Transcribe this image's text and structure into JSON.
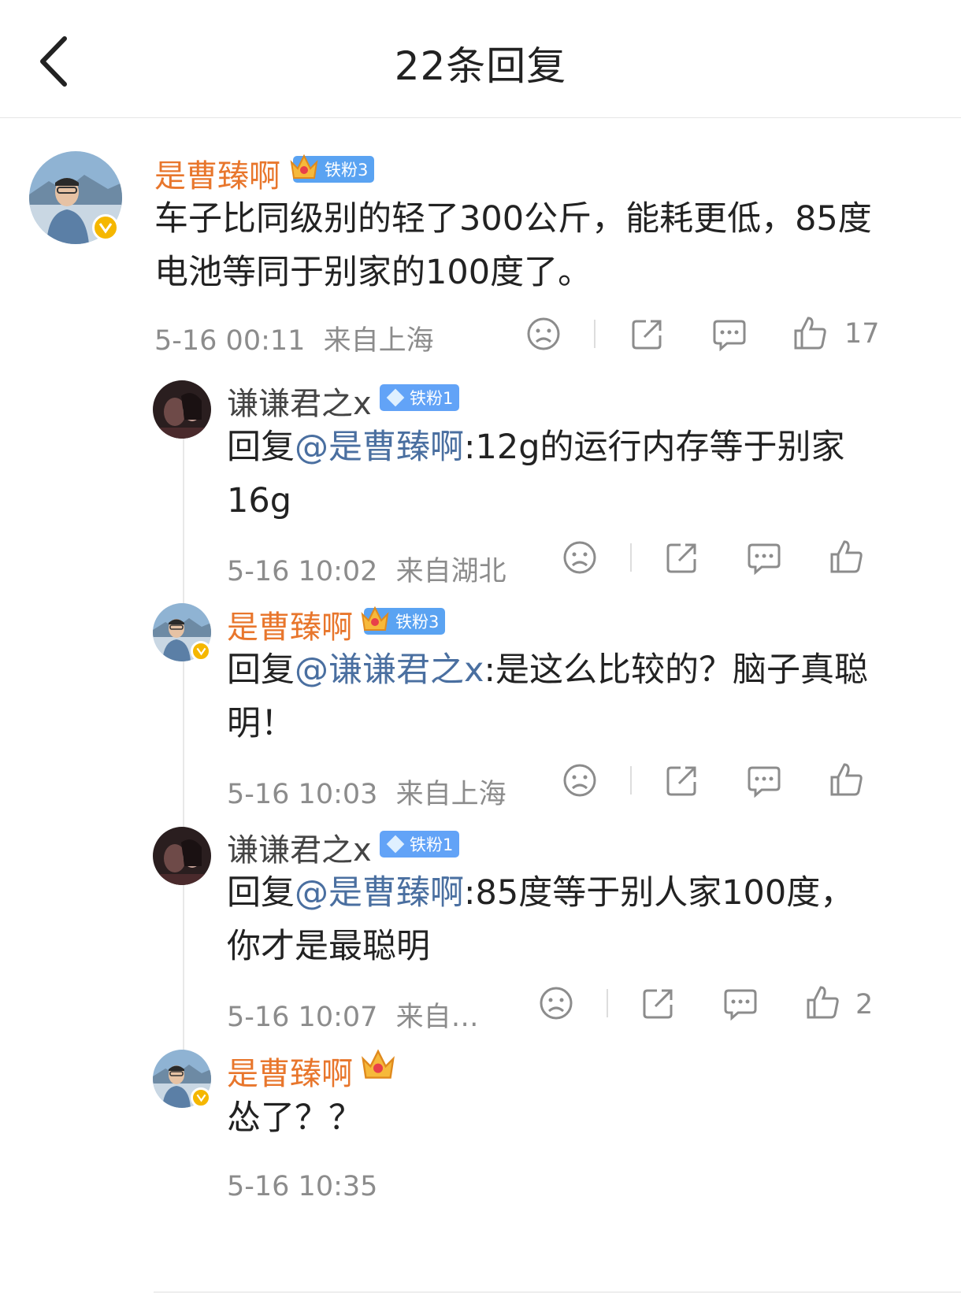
{
  "header": {
    "title": "22条回复"
  },
  "main_comment": {
    "author": "是曹臻啊",
    "fan_badge": "铁粉3",
    "text": "车子比同级别的轻了300公斤，能耗更低，85度电池等同于别家的100度了。",
    "time": "5-16 00:11",
    "location": "来自上海",
    "likes": "17"
  },
  "replies": [
    {
      "author": "谦谦君之x",
      "fan_badge": "铁粉1",
      "prefix": "回复",
      "mention": "@是曹臻啊",
      "text": ":12g的运行内存等于别家16g",
      "time": "5-16 10:02",
      "location": "来自湖北",
      "likes": ""
    },
    {
      "author": "是曹臻啊",
      "fan_badge": "铁粉3",
      "prefix": "回复",
      "mention": "@谦谦君之x",
      "text": ":是这么比较的？脑子真聪明！",
      "time": "5-16 10:03",
      "location": "来自上海",
      "likes": ""
    },
    {
      "author": "谦谦君之x",
      "fan_badge": "铁粉1",
      "prefix": "回复",
      "mention": "@是曹臻啊",
      "text": ":85度等于别人家100度，你才是最聪明",
      "time": "5-16 10:07",
      "location": "来自…",
      "likes": "2"
    },
    {
      "author": "是曹臻啊",
      "text": "怂了？？",
      "time": "5-16 10:35"
    }
  ],
  "icons": {
    "back": "chevron-left-icon",
    "dislike": "sad-face-icon",
    "share": "share-icon",
    "comment": "comment-icon",
    "like": "thumbs-up-icon"
  },
  "colors": {
    "author_orange": "#e8762c",
    "mention_blue": "#4a6fa0",
    "meta_gray": "#8c8c8c",
    "badge_blue": "#62a3f7",
    "verified_gold": "#f5b700"
  }
}
